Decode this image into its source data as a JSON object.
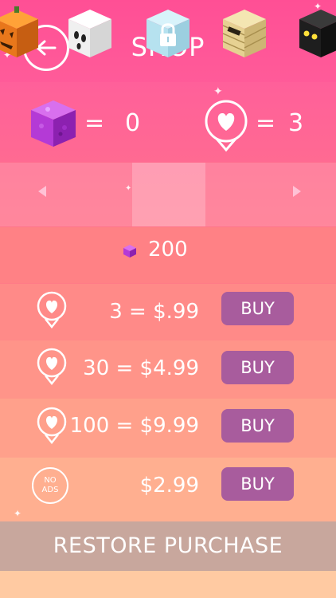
{
  "header": {
    "title": "SHOP"
  },
  "balance": {
    "cubes_equals": "=",
    "cubes_count": "0",
    "lives_equals": "=",
    "lives_count": "3"
  },
  "carousel": {
    "skins": [
      {
        "name": "pumpkin"
      },
      {
        "name": "ghost"
      },
      {
        "name": "ice-locked"
      },
      {
        "name": "mummy"
      },
      {
        "name": "ninja"
      }
    ],
    "selected_price": "200"
  },
  "purchases": [
    {
      "icon": "heart-pin-icon",
      "amount": "3 = $.99",
      "button": "BUY"
    },
    {
      "icon": "heart-pin-icon",
      "amount": "30 = $4.99",
      "button": "BUY"
    },
    {
      "icon": "heart-pin-icon",
      "amount": "100 = $9.99",
      "button": "BUY"
    },
    {
      "icon": "no-ads-icon",
      "icon_text_1": "NO",
      "icon_text_2": "ADS",
      "amount": "$2.99",
      "button": "BUY"
    }
  ],
  "restore": {
    "label": "RESTORE PURCHASE"
  },
  "colors": {
    "buy_button": "#a85c9d",
    "restore_bar": "#c8a79d",
    "cube_purple": "#b43ad6"
  }
}
